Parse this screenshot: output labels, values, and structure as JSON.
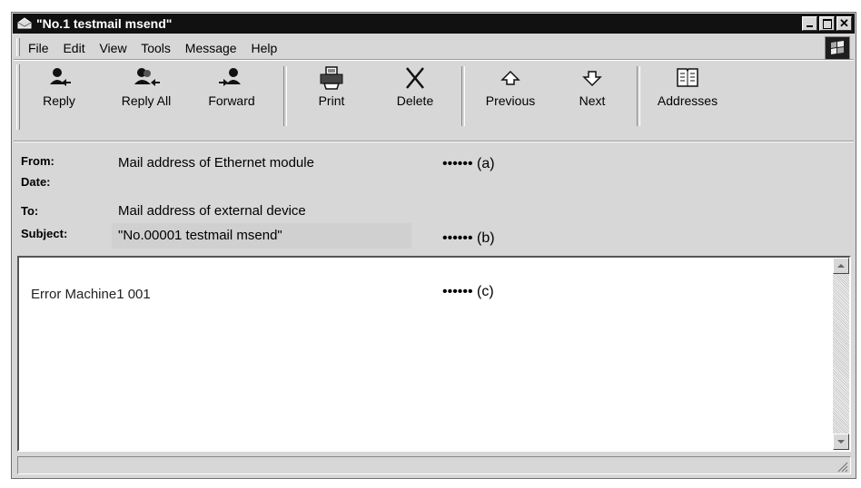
{
  "window": {
    "title": "\"No.1 testmail msend\""
  },
  "menu": [
    "File",
    "Edit",
    "View",
    "Tools",
    "Message",
    "Help"
  ],
  "toolbar": {
    "reply": "Reply",
    "reply_all": "Reply All",
    "forward": "Forward",
    "print": "Print",
    "delete": "Delete",
    "previous": "Previous",
    "next": "Next",
    "addresses": "Addresses"
  },
  "header": {
    "from_label": "From:",
    "from_value": "Mail address of Ethernet module",
    "date_label": "Date:",
    "date_value": "",
    "to_label": "To:",
    "to_value": "Mail address of external device",
    "subject_label": "Subject:",
    "subject_value": "\"No.00001 testmail msend\""
  },
  "body": {
    "text": "Error Machine1 001"
  },
  "annotations": {
    "a": "•••••• (a)",
    "b": "•••••• (b)",
    "c": "•••••• (c)"
  },
  "icons": [
    "envelope-icon",
    "window-logo-icon",
    "reply-icon",
    "reply-all-icon",
    "forward-icon",
    "print-icon",
    "delete-icon",
    "previous-icon",
    "next-icon",
    "addresses-icon",
    "resize-grip-icon"
  ]
}
